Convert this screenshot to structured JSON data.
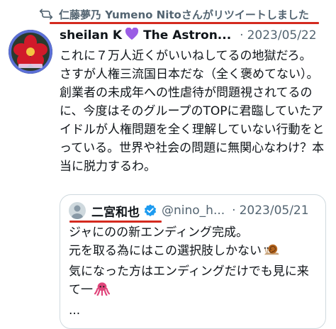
{
  "retweet": {
    "icon": "retweet-icon",
    "text": "仁藤夢乃  Yumeno Nitoさんがリツイートしました"
  },
  "tweet": {
    "author_name": "sheilan K",
    "author_emoji": "purple-heart-icon",
    "author_name_2": "The Astron...",
    "separator": "·",
    "date": "2023/05/22",
    "body": [
      "これに７万人近くがいいねしてるの地獄だろ。",
      "さすが人権三流国日本だな（全く褒めてない）。",
      "創業者の未成年への性虐待が問題視されてるのに、今度はそのグループのTOPに君臨していたアイドルが人権問題を全く理解していない行動をとっている。世界や社会の問題に無関心なわけ？本当に脱力するわ。"
    ]
  },
  "quote": {
    "name": "二宮和也",
    "verified": "verified-badge-icon",
    "handle": "@nino_h...",
    "separator": "·",
    "date": "2023/05/21",
    "line1": "ジャにのの新エンディング完成。",
    "line2": "元を取る為にはこの選択肢しかない",
    "line3": "気になった方はエンディングだけでも見に来て一",
    "line4": "...",
    "emoji_snail": "snail-icon",
    "emoji_octopus": "octopus-icon"
  },
  "colors": {
    "annotation_red": "#d42a1f",
    "text_secondary": "#536471",
    "verified_blue": "#1d9bf0",
    "heart_purple": "#9b5de5"
  }
}
